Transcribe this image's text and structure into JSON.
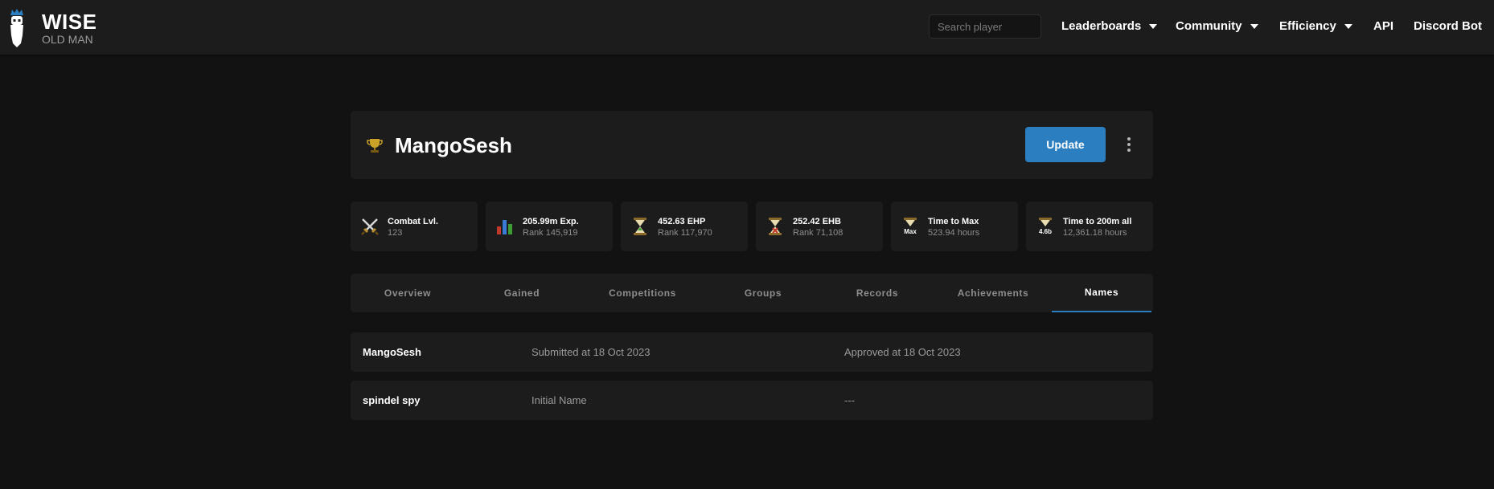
{
  "brand": {
    "title": "WISE",
    "subtitle": "OLD MAN"
  },
  "search": {
    "placeholder": "Search player",
    "value": ""
  },
  "nav": [
    {
      "label": "Leaderboards",
      "dropdown": true
    },
    {
      "label": "Community",
      "dropdown": true
    },
    {
      "label": "Efficiency",
      "dropdown": true
    },
    {
      "label": "API",
      "dropdown": false
    },
    {
      "label": "Discord Bot",
      "dropdown": false
    }
  ],
  "player": {
    "name": "MangoSesh",
    "update_label": "Update"
  },
  "stats": [
    {
      "label": "Combat Lvl.",
      "value": "123",
      "icon": "crossed-swords-icon"
    },
    {
      "label": "205.99m Exp.",
      "value": "Rank 145,919",
      "icon": "bar-chart-icon"
    },
    {
      "label": "452.63 EHP",
      "value": "Rank 117,970",
      "icon": "hourglass-skill-icon"
    },
    {
      "label": "252.42 EHB",
      "value": "Rank 71,108",
      "icon": "hourglass-boss-icon"
    },
    {
      "label": "Time to Max",
      "value": "523.94 hours",
      "icon": "hourglass-max-icon",
      "badge": "Max"
    },
    {
      "label": "Time to 200m all",
      "value": "12,361.18 hours",
      "icon": "hourglass-200m-icon",
      "badge": "4.6b"
    }
  ],
  "tabs": [
    {
      "label": "Overview"
    },
    {
      "label": "Gained"
    },
    {
      "label": "Competitions"
    },
    {
      "label": "Groups"
    },
    {
      "label": "Records"
    },
    {
      "label": "Achievements"
    },
    {
      "label": "Names",
      "active": true
    }
  ],
  "names": [
    {
      "name": "MangoSesh",
      "submitted": "Submitted at 18 Oct 2023",
      "approved": "Approved at 18 Oct 2023"
    },
    {
      "name": "spindel spy",
      "submitted": "Initial Name",
      "approved": "---"
    }
  ],
  "colors": {
    "accent": "#2b7ec0",
    "background": "#121212",
    "card": "#1c1c1c"
  }
}
